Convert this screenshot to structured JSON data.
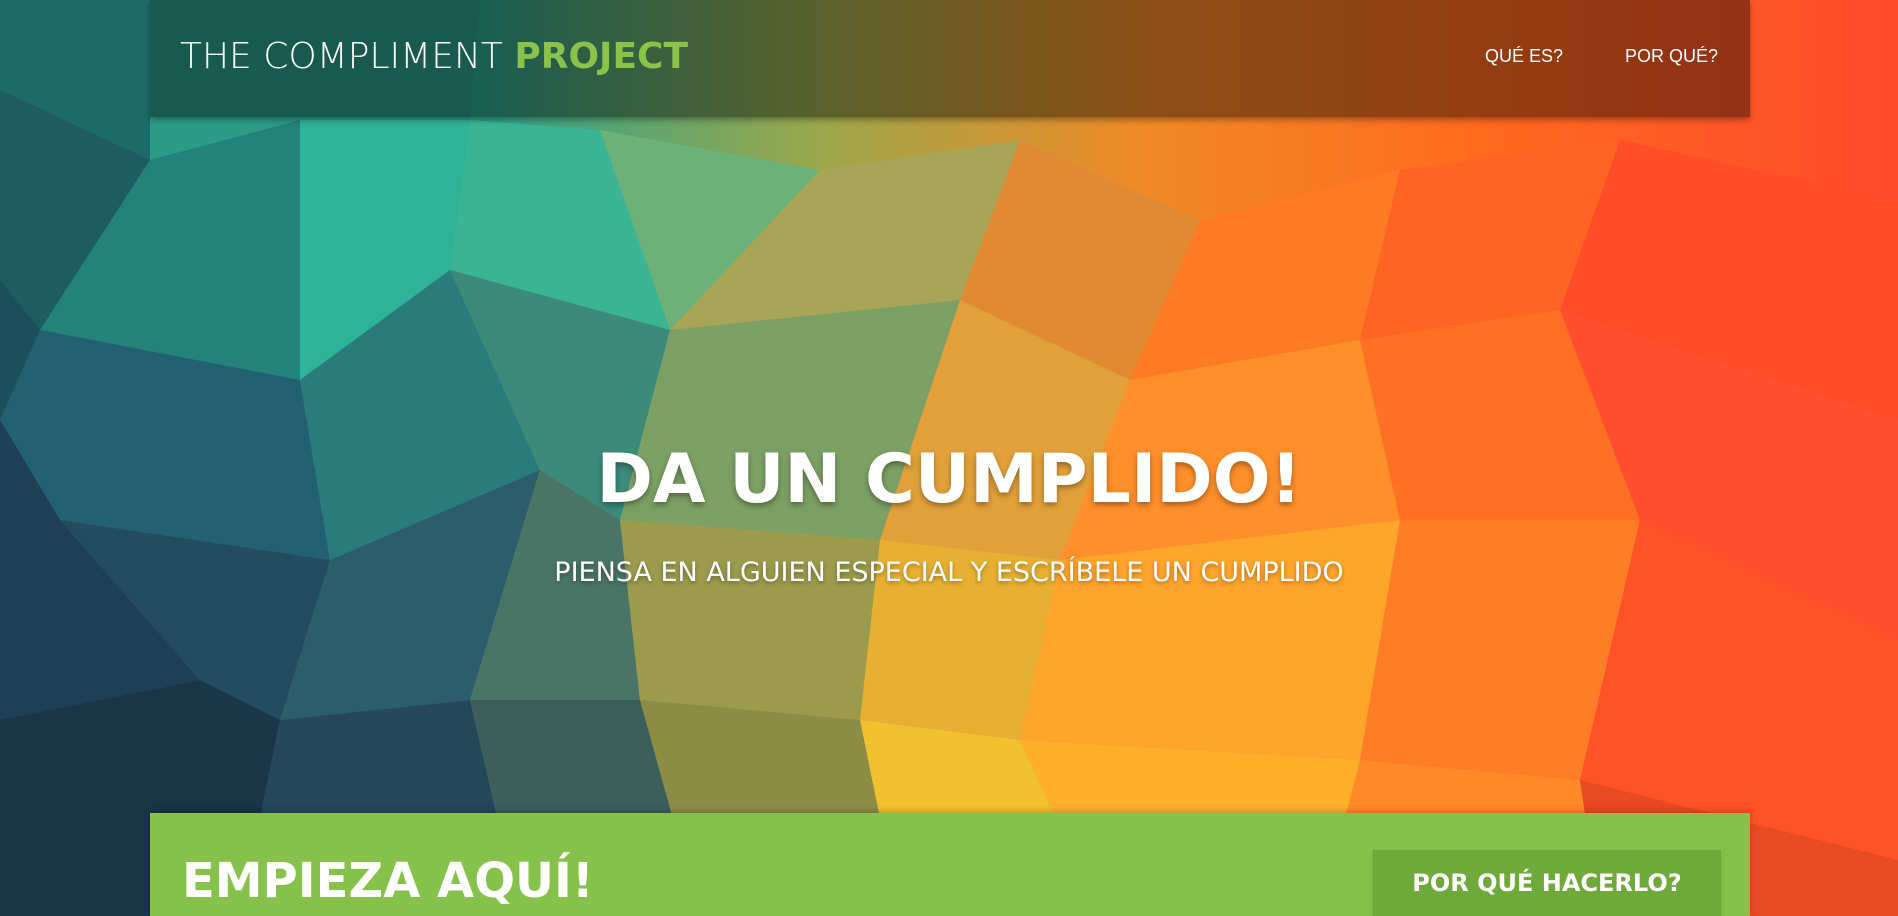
{
  "brand": {
    "part1": "THE COMPLIMENT ",
    "part2": "PROJECT"
  },
  "nav": {
    "items": [
      {
        "label": "QUÉ ES?"
      },
      {
        "label": "POR QUÉ?"
      }
    ]
  },
  "hero": {
    "headline": "DA UN CUMPLIDO!",
    "subheadline": "PIENSA EN ALGUIEN ESPECIAL Y ESCRÍBELE UN CUMPLIDO"
  },
  "cta": {
    "title": "EMPIEZA AQUÍ!",
    "button_label": "POR QUÉ HACERLO?"
  },
  "colors": {
    "accent": "#8bc34a",
    "panel": "#86c14b",
    "button": "#6fa93a",
    "nav_overlay": "rgba(0,0,0,0.42)"
  }
}
